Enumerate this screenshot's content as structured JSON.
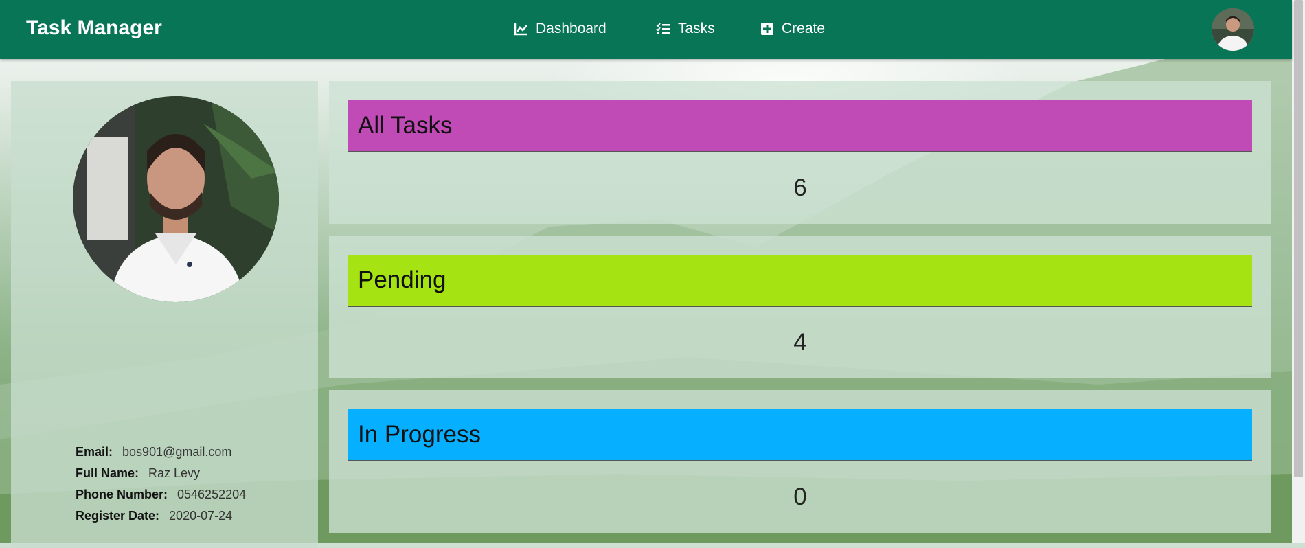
{
  "app": {
    "brand": "Task Manager"
  },
  "nav": {
    "items": [
      {
        "label": "Dashboard",
        "icon": "chart-line-icon"
      },
      {
        "label": "Tasks",
        "icon": "task-list-icon"
      },
      {
        "label": "Create",
        "icon": "plus-square-icon"
      }
    ]
  },
  "profile": {
    "email_label": "Email:",
    "email": "bos901@gmail.com",
    "fullname_label": "Full Name:",
    "fullname": "Raz Levy",
    "phone_label": "Phone Number:",
    "phone": "0546252204",
    "register_label": "Register Date:",
    "register_date": "2020-07-24"
  },
  "stats": [
    {
      "title": "All Tasks",
      "count": "6",
      "color": "#c04ab6"
    },
    {
      "title": "Pending",
      "count": "4",
      "color": "#a6e313"
    },
    {
      "title": "In Progress",
      "count": "0",
      "color": "#06afff"
    }
  ],
  "colors": {
    "navbar": "#077556"
  }
}
